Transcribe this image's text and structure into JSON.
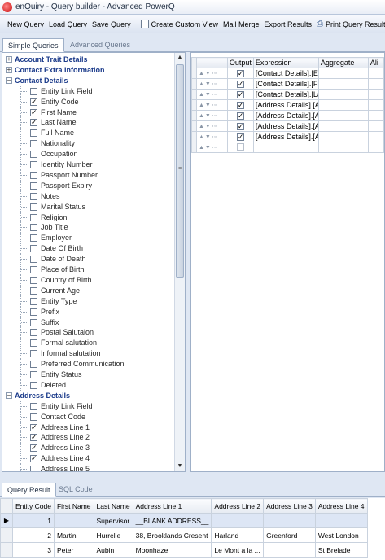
{
  "window": {
    "title": "enQuiry - Query builder - Advanced PowerQ"
  },
  "toolbar": {
    "new_query": "New Query",
    "load_query": "Load Query",
    "save_query": "Save Query",
    "create_custom_view": "Create Custom View",
    "mail_merge": "Mail Merge",
    "export_results": "Export Results",
    "print_query_result": "Print Query Result"
  },
  "top_tabs": [
    "Simple Queries",
    "Advanced Queries"
  ],
  "tree": [
    {
      "type": "group",
      "label": "Account Trait Details",
      "expanded": false
    },
    {
      "type": "group",
      "label": "Contact Extra Information",
      "expanded": false
    },
    {
      "type": "group",
      "label": "Contact Details",
      "expanded": true
    },
    {
      "type": "item",
      "label": "Entity Link Field",
      "checked": false
    },
    {
      "type": "item",
      "label": "Entity Code",
      "checked": true
    },
    {
      "type": "item",
      "label": "First Name",
      "checked": true
    },
    {
      "type": "item",
      "label": "Last Name",
      "checked": true
    },
    {
      "type": "item",
      "label": "Full Name",
      "checked": false
    },
    {
      "type": "item",
      "label": "Nationality",
      "checked": false
    },
    {
      "type": "item",
      "label": "Occupation",
      "checked": false
    },
    {
      "type": "item",
      "label": "Identity Number",
      "checked": false
    },
    {
      "type": "item",
      "label": "Passport Number",
      "checked": false
    },
    {
      "type": "item",
      "label": "Passport Expiry",
      "checked": false
    },
    {
      "type": "item",
      "label": "Notes",
      "checked": false
    },
    {
      "type": "item",
      "label": "Marital Status",
      "checked": false
    },
    {
      "type": "item",
      "label": "Religion",
      "checked": false
    },
    {
      "type": "item",
      "label": "Job Title",
      "checked": false
    },
    {
      "type": "item",
      "label": "Employer",
      "checked": false
    },
    {
      "type": "item",
      "label": "Date Of Birth",
      "checked": false
    },
    {
      "type": "item",
      "label": "Date of Death",
      "checked": false
    },
    {
      "type": "item",
      "label": "Place of Birth",
      "checked": false
    },
    {
      "type": "item",
      "label": "Country of Birth",
      "checked": false
    },
    {
      "type": "item",
      "label": "Current Age",
      "checked": false
    },
    {
      "type": "item",
      "label": "Entity Type",
      "checked": false
    },
    {
      "type": "item",
      "label": "Prefix",
      "checked": false
    },
    {
      "type": "item",
      "label": "Suffix",
      "checked": false
    },
    {
      "type": "item",
      "label": "Postal Salutaion",
      "checked": false
    },
    {
      "type": "item",
      "label": "Formal salutation",
      "checked": false
    },
    {
      "type": "item",
      "label": "Informal salutation",
      "checked": false
    },
    {
      "type": "item",
      "label": "Preferred Communication",
      "checked": false
    },
    {
      "type": "item",
      "label": "Entity Status",
      "checked": false
    },
    {
      "type": "item",
      "label": "Deleted",
      "checked": false
    },
    {
      "type": "group",
      "label": "Address Details",
      "expanded": true
    },
    {
      "type": "item",
      "label": "Entity Link Field",
      "checked": false
    },
    {
      "type": "item",
      "label": "Contact Code",
      "checked": false
    },
    {
      "type": "item",
      "label": "Address Line 1",
      "checked": true
    },
    {
      "type": "item",
      "label": "Address Line 2",
      "checked": true
    },
    {
      "type": "item",
      "label": "Address Line 3",
      "checked": true
    },
    {
      "type": "item",
      "label": "Address Line 4",
      "checked": true
    },
    {
      "type": "item",
      "label": "Address Line 5",
      "checked": false
    }
  ],
  "query_grid": {
    "headers": {
      "output": "Output",
      "expression": "Expression",
      "aggregate": "Aggregate",
      "alias": "Ali"
    },
    "row_controls": "▲▼▫▫",
    "rows": [
      {
        "output": true,
        "expression": "[Contact Details].[En",
        "aggregate": ""
      },
      {
        "output": true,
        "expression": "[Contact Details].[Firs",
        "aggregate": ""
      },
      {
        "output": true,
        "expression": "[Contact Details].[Las",
        "aggregate": ""
      },
      {
        "output": true,
        "expression": "[Address Details].[Ad",
        "aggregate": ""
      },
      {
        "output": true,
        "expression": "[Address Details].[Ad",
        "aggregate": ""
      },
      {
        "output": true,
        "expression": "[Address Details].[Ad",
        "aggregate": ""
      },
      {
        "output": true,
        "expression": "[Address Details].[Ad",
        "aggregate": ""
      },
      {
        "output": false,
        "expression": "",
        "aggregate": ""
      }
    ]
  },
  "bottom_tabs": [
    "Query Result",
    "SQL Code"
  ],
  "results": {
    "columns": [
      "Entity Code",
      "First Name",
      "Last Name",
      "Address Line 1",
      "Address Line 2",
      "Address Line 3",
      "Address Line 4"
    ],
    "rows": [
      [
        "1",
        "",
        "Supervisor",
        "__BLANK ADDRESS__",
        "",
        "",
        ""
      ],
      [
        "2",
        "Martin",
        "Hurrelle",
        "38, Brooklands Cresent",
        "Harland",
        "Greenford",
        "West London"
      ],
      [
        "3",
        "Peter",
        "Aubin",
        "Moonhaze",
        "Le Mont a la ...",
        "",
        "St Brelade"
      ]
    ]
  }
}
